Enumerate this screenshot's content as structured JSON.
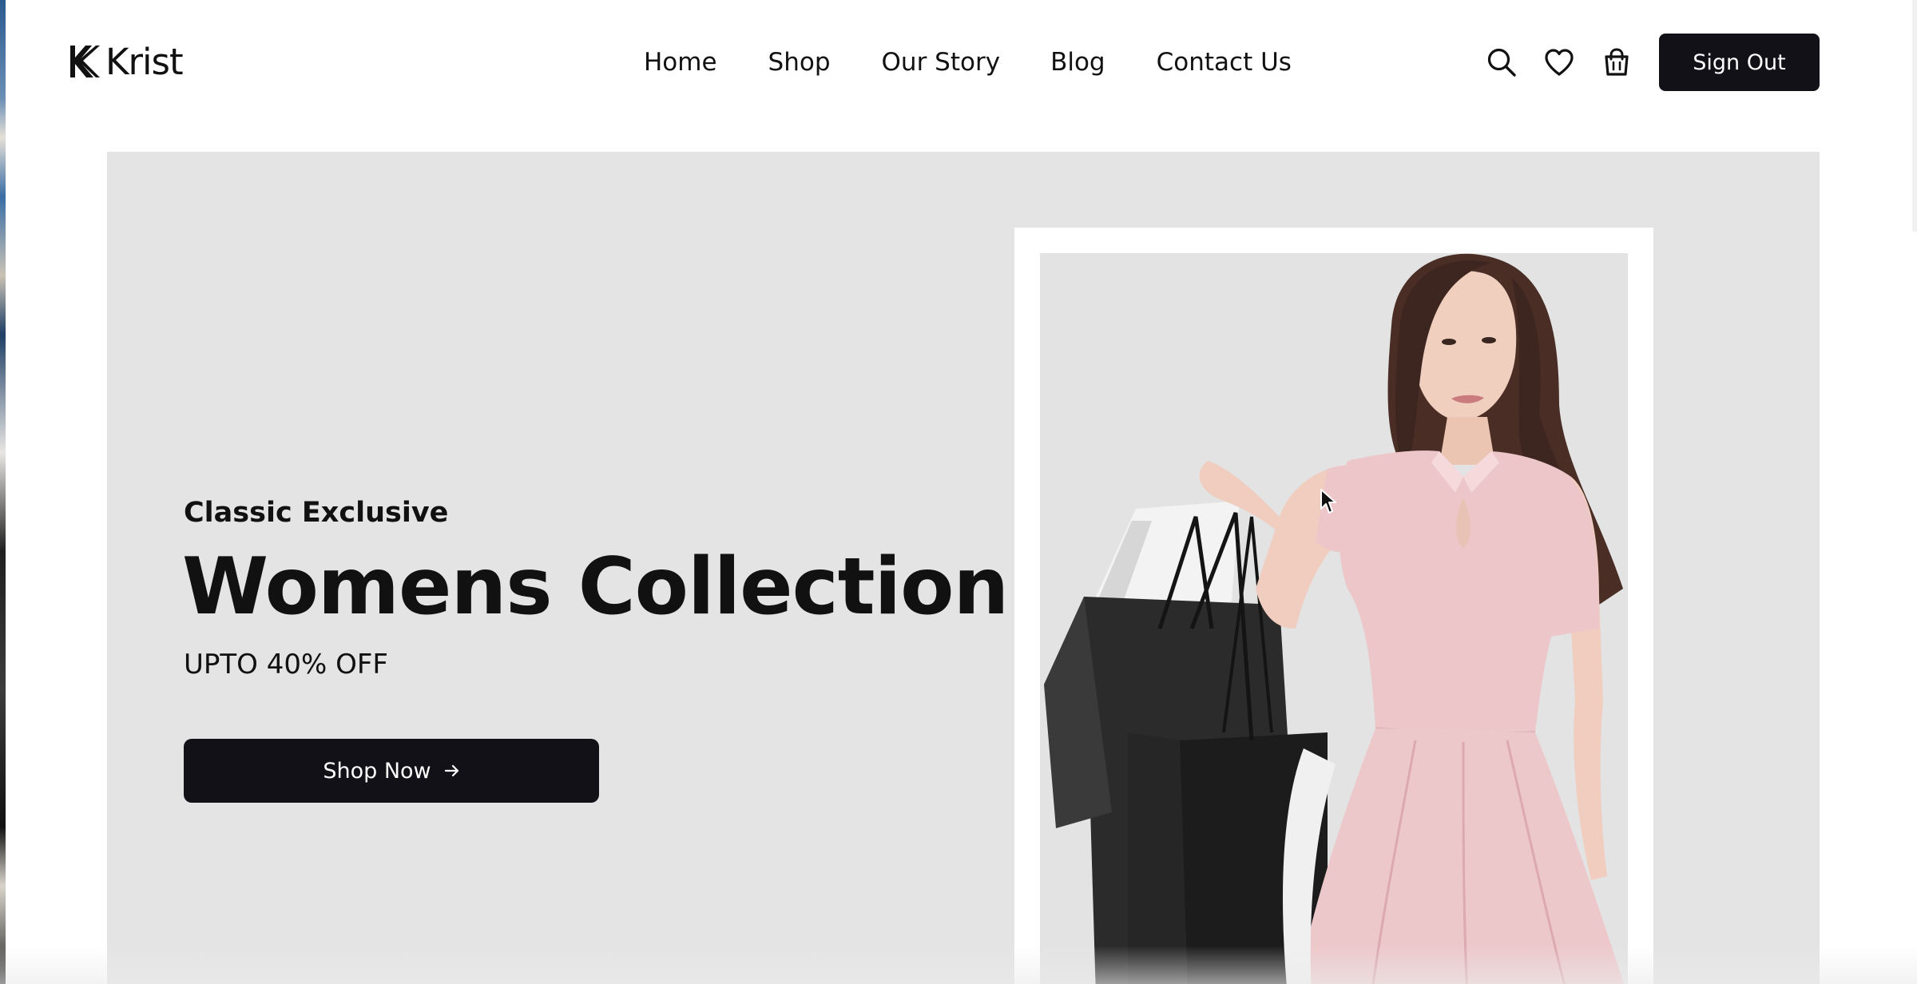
{
  "brand": {
    "name": "Krist",
    "logo_icon": "k-logo-icon"
  },
  "nav": {
    "items": [
      {
        "label": "Home"
      },
      {
        "label": "Shop"
      },
      {
        "label": "Our Story"
      },
      {
        "label": "Blog"
      },
      {
        "label": "Contact Us"
      }
    ]
  },
  "header_actions": {
    "search_icon": "search-icon",
    "wishlist_icon": "heart-icon",
    "cart_icon": "shopping-bag-icon",
    "sign_out_label": "Sign Out"
  },
  "hero": {
    "subtitle": "Classic Exclusive",
    "title": "Womens Collection",
    "offer": "UPTO 40% OFF",
    "cta_label": "Shop Now",
    "cta_icon": "arrow-right-icon",
    "image": "woman-with-shopping-bags-photo"
  },
  "colors": {
    "primary_dark": "#131118",
    "hero_background": "#e4e4e4",
    "dress_pink": "#ecc6c9"
  }
}
